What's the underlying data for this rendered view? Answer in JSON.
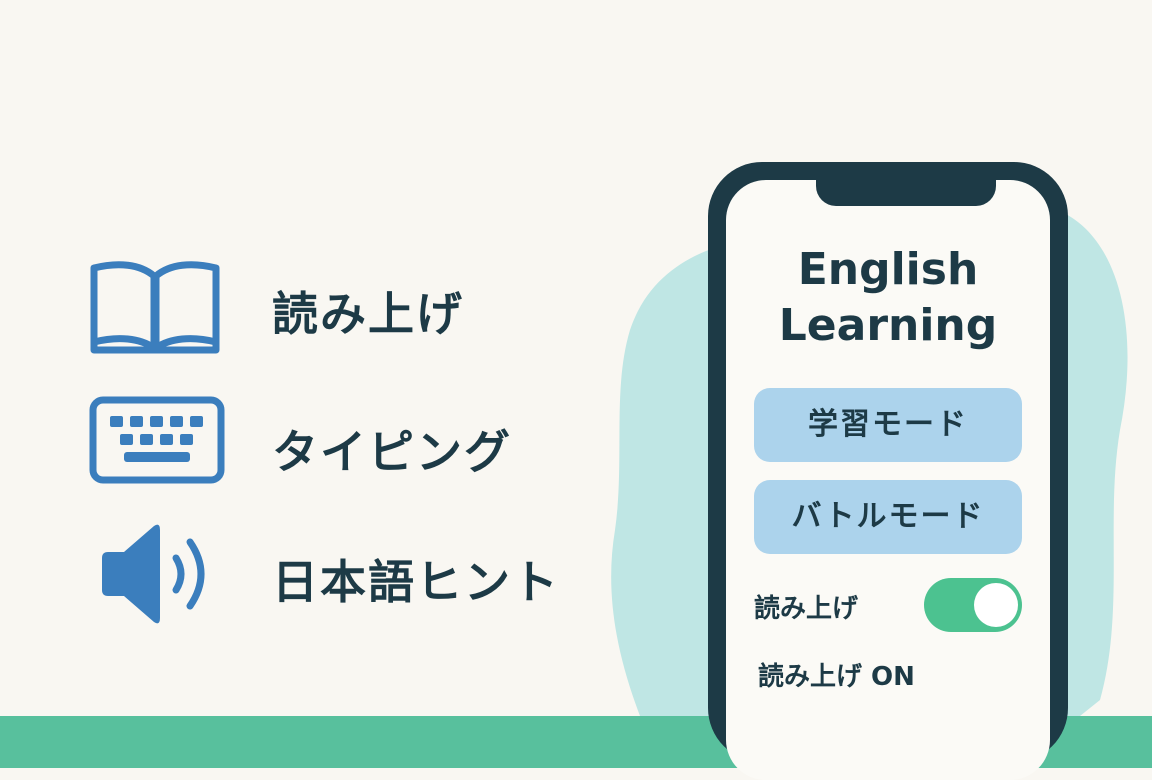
{
  "colors": {
    "background": "#f9f7f2",
    "accent_green": "#58c09d",
    "icon_blue": "#3b7ebd",
    "text_dark": "#1d3a46",
    "button_blue": "#acd3ec",
    "blob_teal": "#bfe6e4",
    "toggle_on": "#4cc290"
  },
  "features": [
    {
      "icon": "open-book-icon",
      "label": "読み上げ"
    },
    {
      "icon": "keyboard-icon",
      "label": "タイピング"
    },
    {
      "icon": "speaker-icon",
      "label": "日本語ヒント"
    }
  ],
  "phone": {
    "title_line1": "English",
    "title_line2": "Learning",
    "buttons": {
      "learn_mode": "学習モード",
      "battle_mode": "バトルモード"
    },
    "toggle": {
      "label": "読み上げ",
      "on": true
    },
    "status_text": "読み上げ ON"
  }
}
